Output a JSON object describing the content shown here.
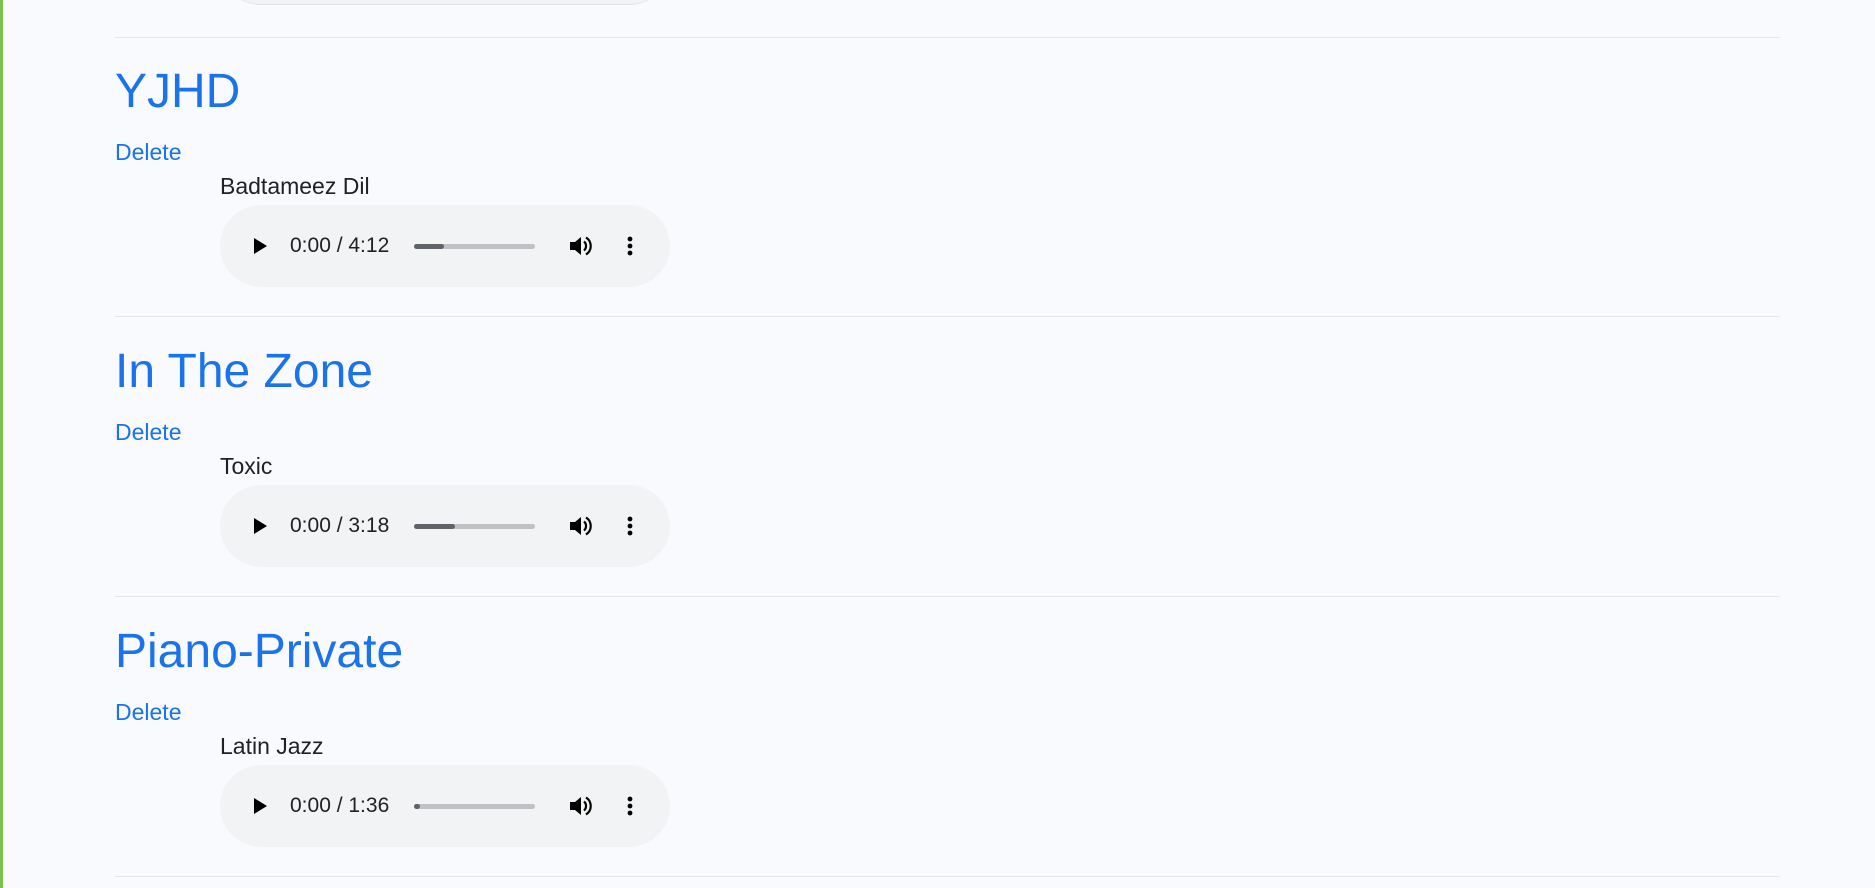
{
  "playlists": [
    {
      "title": "YJHD",
      "delete_label": "Delete",
      "song": {
        "title": "Badtameez Dil",
        "time": "0:00 / 4:12",
        "buffered_fraction": 0.25
      }
    },
    {
      "title": "In The Zone",
      "delete_label": "Delete",
      "song": {
        "title": "Toxic",
        "time": "0:00 / 3:18",
        "buffered_fraction": 0.34
      }
    },
    {
      "title": "Piano-Private",
      "delete_label": "Delete",
      "song": {
        "title": "Latin Jazz",
        "time": "0:00 / 1:36",
        "buffered_fraction": 0.05
      }
    }
  ],
  "icons": {
    "play": "play-icon",
    "volume": "volume-icon",
    "more": "more-vert-icon"
  },
  "colors": {
    "accent": "#1a73e8",
    "text": "#202124",
    "left_edge": "#7cc24a"
  }
}
